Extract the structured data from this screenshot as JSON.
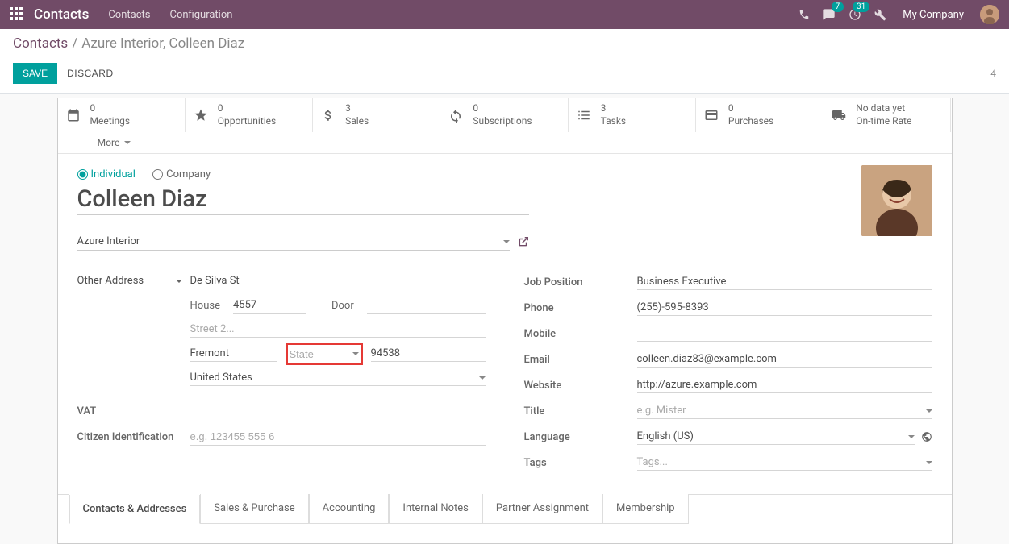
{
  "navbar": {
    "brand": "Contacts",
    "links": [
      "Contacts",
      "Configuration"
    ],
    "chat_badge": "7",
    "activity_badge": "31",
    "company": "My Company"
  },
  "breadcrumb": {
    "root": "Contacts",
    "current": "Azure Interior, Colleen Diaz"
  },
  "actions": {
    "save": "SAVE",
    "discard": "DISCARD",
    "page": "4"
  },
  "stats": {
    "meetings": {
      "count": "0",
      "label": "Meetings"
    },
    "opportunities": {
      "count": "0",
      "label": "Opportunities"
    },
    "sales": {
      "count": "3",
      "label": "Sales"
    },
    "subscriptions": {
      "count": "0",
      "label": "Subscriptions"
    },
    "tasks": {
      "count": "3",
      "label": "Tasks"
    },
    "purchases": {
      "count": "0",
      "label": "Purchases"
    },
    "ontime": {
      "count": "No data yet",
      "label": "On-time Rate"
    },
    "more": "More"
  },
  "radio": {
    "individual": "Individual",
    "company": "Company"
  },
  "name": "Colleen Diaz",
  "parent_company": "Azure Interior",
  "address": {
    "type": "Other Address",
    "street": "De Silva St",
    "house_label": "House",
    "house": "4557",
    "door_label": "Door",
    "door": "",
    "street2_placeholder": "Street 2...",
    "city": "Fremont",
    "state_placeholder": "State",
    "zip": "94538",
    "country": "United States"
  },
  "left": {
    "vat_label": "VAT",
    "citizen_label": "Citizen Identification",
    "citizen_placeholder": "e.g. 123455 555 6"
  },
  "right": {
    "job_label": "Job Position",
    "job": "Business Executive",
    "phone_label": "Phone",
    "phone": "(255)-595-8393",
    "mobile_label": "Mobile",
    "mobile": "",
    "email_label": "Email",
    "email": "colleen.diaz83@example.com",
    "website_label": "Website",
    "website": "http://azure.example.com",
    "title_label": "Title",
    "title_placeholder": "e.g. Mister",
    "language_label": "Language",
    "language": "English (US)",
    "tags_label": "Tags",
    "tags_placeholder": "Tags..."
  },
  "tabs": [
    "Contacts & Addresses",
    "Sales & Purchase",
    "Accounting",
    "Internal Notes",
    "Partner Assignment",
    "Membership"
  ]
}
